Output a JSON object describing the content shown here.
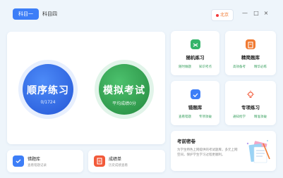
{
  "tabs": [
    {
      "label": "科目一",
      "active": true
    },
    {
      "label": "科目四",
      "active": false
    }
  ],
  "location": {
    "label": "北京"
  },
  "window_controls": {
    "help": "?",
    "minimize": "—",
    "maximize": "□",
    "close": "×"
  },
  "practice": {
    "title": "顺序练习",
    "progress": "0/1724"
  },
  "exam": {
    "title": "模拟考试",
    "subtitle": "平均成绩0分"
  },
  "grid": [
    {
      "title": "随机练习",
      "link1": "随时做题",
      "link2": "知识考点",
      "icon": "shuffle-icon",
      "color": "#34b46a"
    },
    {
      "title": "精简题库",
      "link1": "高效备考",
      "link2": "精华必练",
      "icon": "book-icon",
      "color": "#f07a32"
    },
    {
      "title": "错题库",
      "link1": "查看错题",
      "link2": "专项攻破",
      "icon": "check-icon",
      "color": "#3d7ef7"
    },
    {
      "title": "专项练习",
      "link1": "通知抢学",
      "link2": "精准攻破",
      "icon": "bulb-icon",
      "color": "#f25a3a"
    }
  ],
  "promo": {
    "title": "考前密卷",
    "desc": "为学生特色上网提供的考试题库，多元上网空间，保护学生学习过程更顺利。"
  },
  "bottom": [
    {
      "title": "错题库",
      "sub": "查看错题记录",
      "icon": "check-icon",
      "color": "#3d7ef7"
    },
    {
      "title": "成绩单",
      "sub": "历史成绩查看",
      "icon": "report-icon",
      "color": "#f25a3a"
    }
  ]
}
